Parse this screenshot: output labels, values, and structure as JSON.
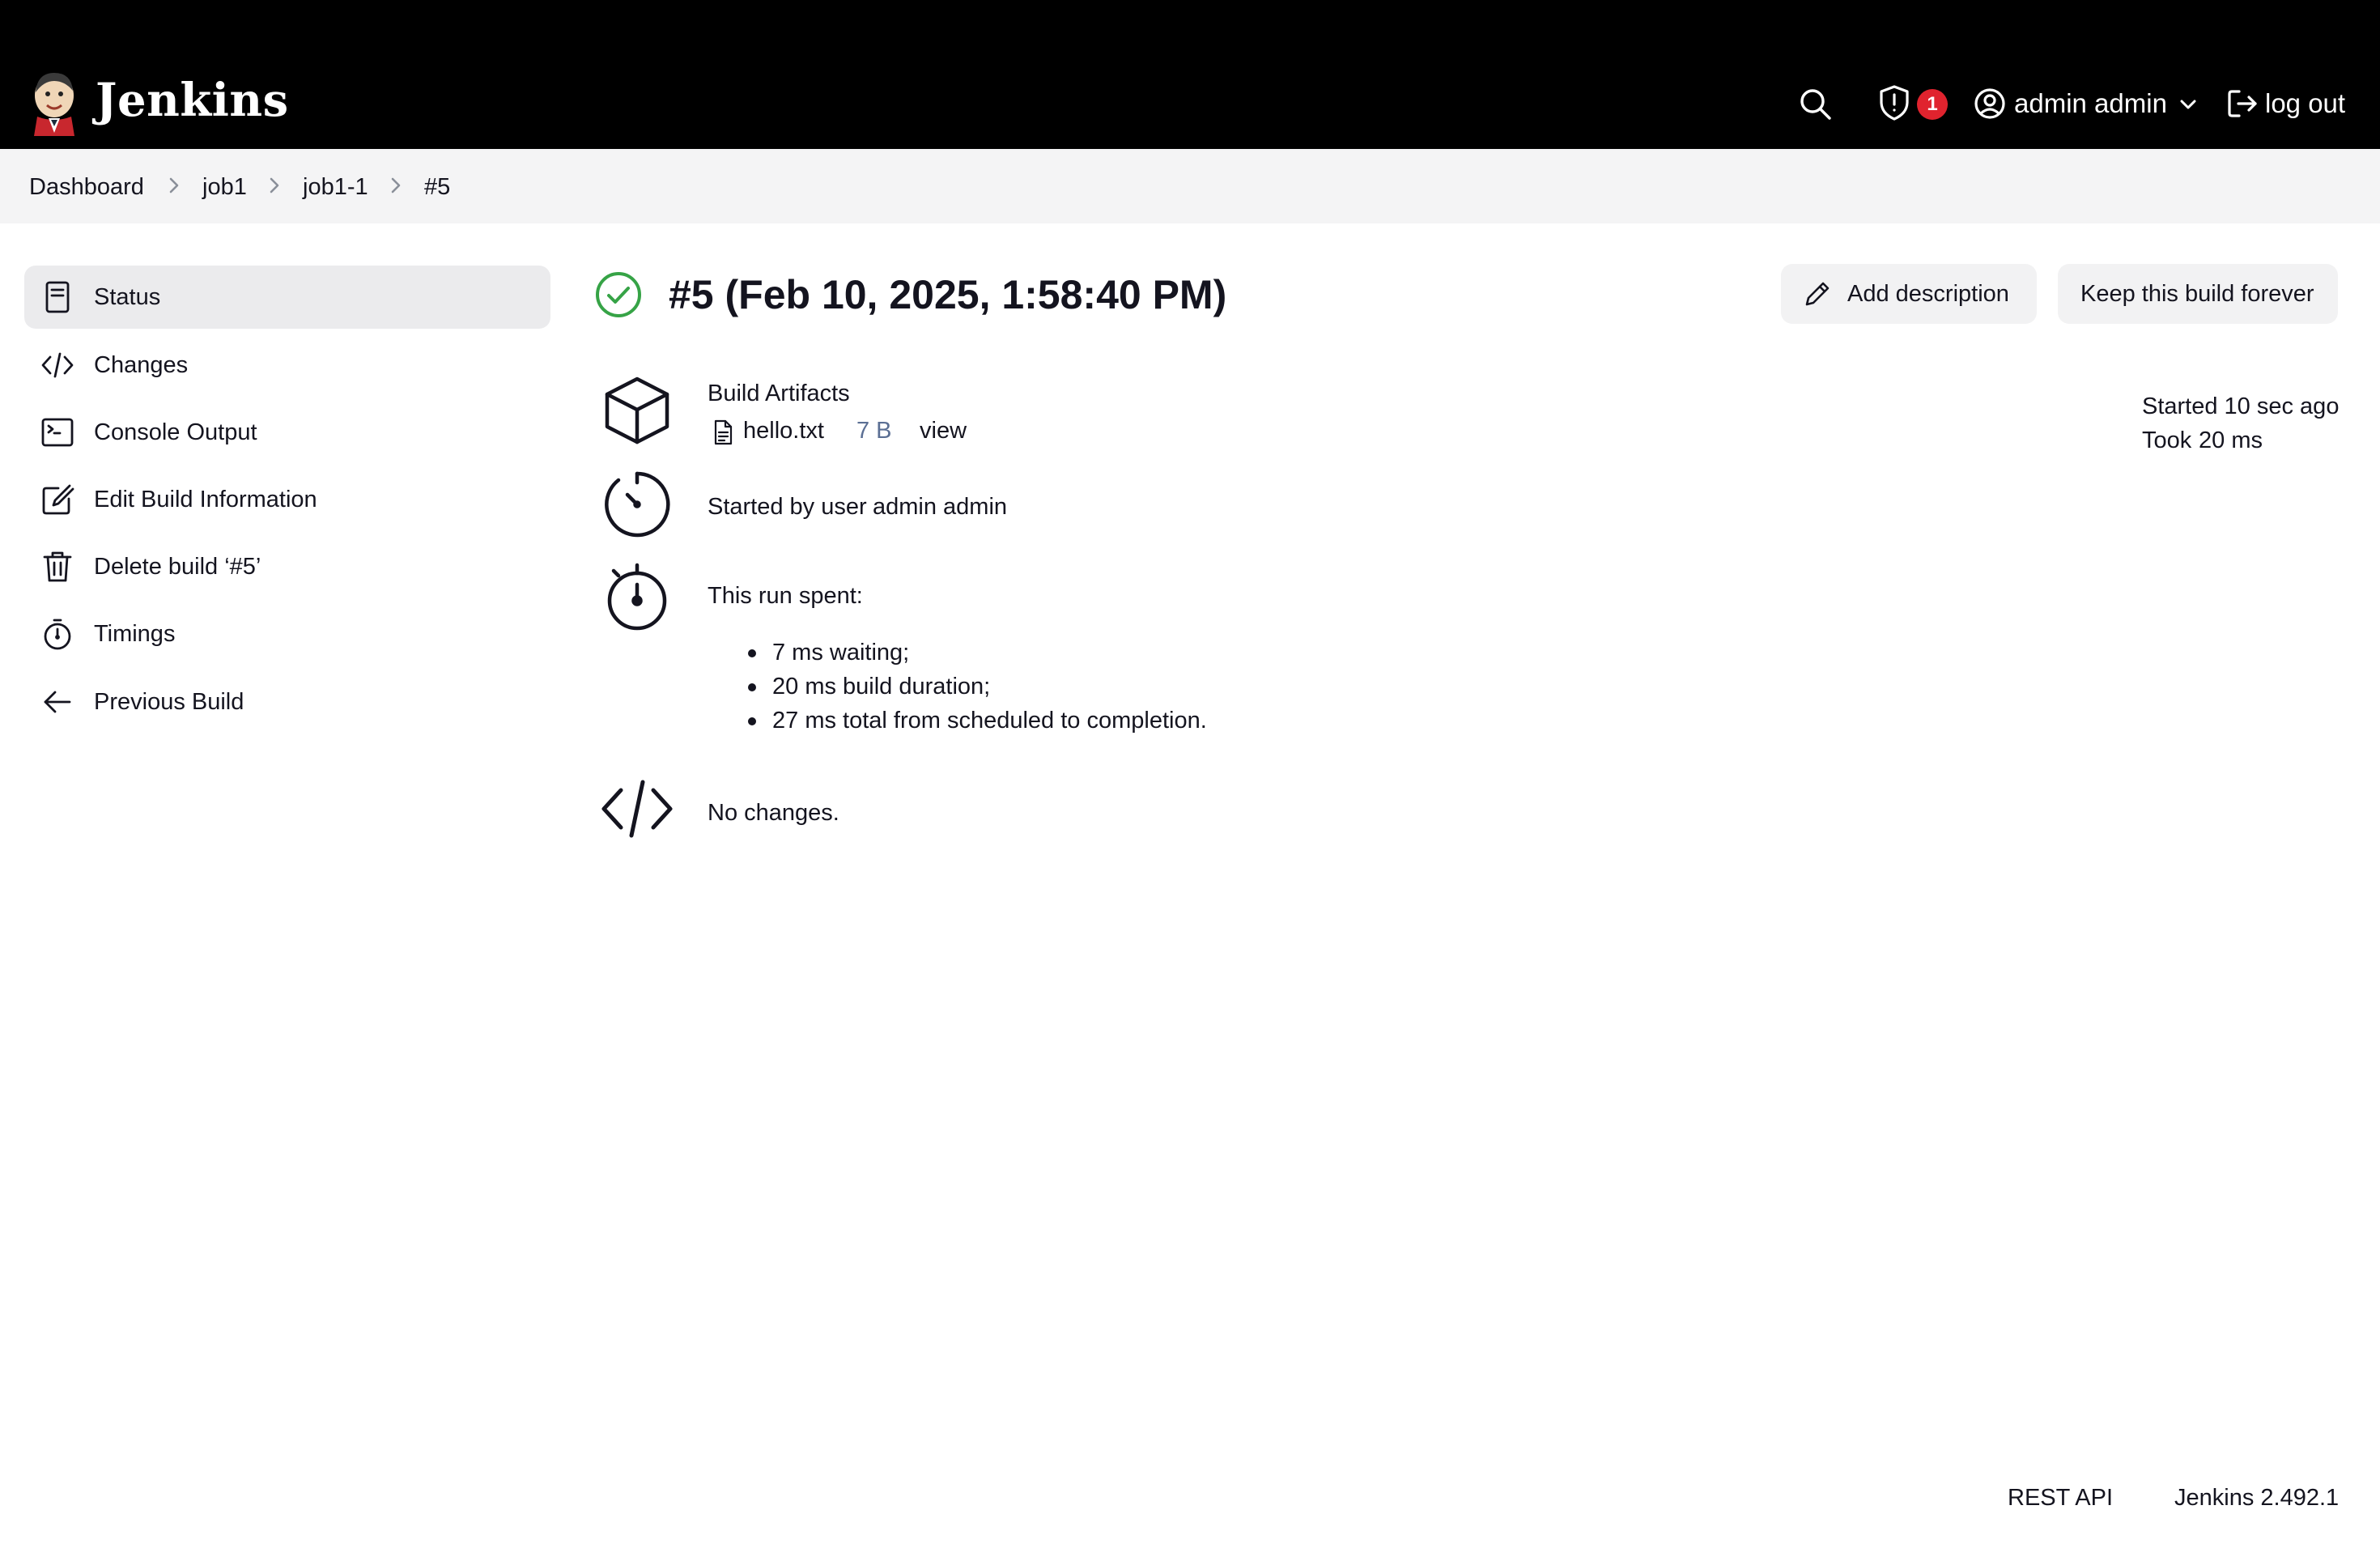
{
  "header": {
    "brand": "Jenkins",
    "security_badge_count": "1",
    "username": "admin admin",
    "logout_label": "log out"
  },
  "breadcrumb": {
    "items": [
      "Dashboard",
      "job1",
      "job1-1",
      "#5"
    ]
  },
  "sidebar": {
    "items": [
      {
        "label": "Status",
        "icon": "status-icon",
        "active": true
      },
      {
        "label": "Changes",
        "icon": "code-icon"
      },
      {
        "label": "Console Output",
        "icon": "terminal-icon"
      },
      {
        "label": "Edit Build Information",
        "icon": "edit-icon"
      },
      {
        "label": "Delete build ‘#5’",
        "icon": "trash-icon"
      },
      {
        "label": "Timings",
        "icon": "stopwatch-icon"
      },
      {
        "label": "Previous Build",
        "icon": "arrow-left-icon"
      }
    ]
  },
  "build": {
    "title": "#5 (Feb 10, 2025, 1:58:40 PM)",
    "status": "success",
    "add_description_label": "Add description",
    "keep_forever_label": "Keep this build forever",
    "started_label": "Started 10 sec ago",
    "took_prefix": "Took",
    "took_value": "20 ms"
  },
  "artifacts": {
    "heading": "Build Artifacts",
    "files": [
      {
        "name": "hello.txt",
        "size": "7 B",
        "view_label": "view"
      }
    ]
  },
  "cause": {
    "prefix": "Started by user",
    "user": "admin admin"
  },
  "timing": {
    "heading": "This run spent:",
    "items": [
      "7 ms waiting;",
      "20 ms build duration;",
      "27 ms total from scheduled to completion."
    ]
  },
  "changes": {
    "text": "No changes."
  },
  "footer": {
    "rest_api": "REST API",
    "version": "Jenkins 2.492.1"
  },
  "colors": {
    "header_bg": "#000000",
    "link": "#1a6ed8",
    "success": "#36a346",
    "badge": "#e0232e",
    "active_item_bg": "#ebebed"
  }
}
